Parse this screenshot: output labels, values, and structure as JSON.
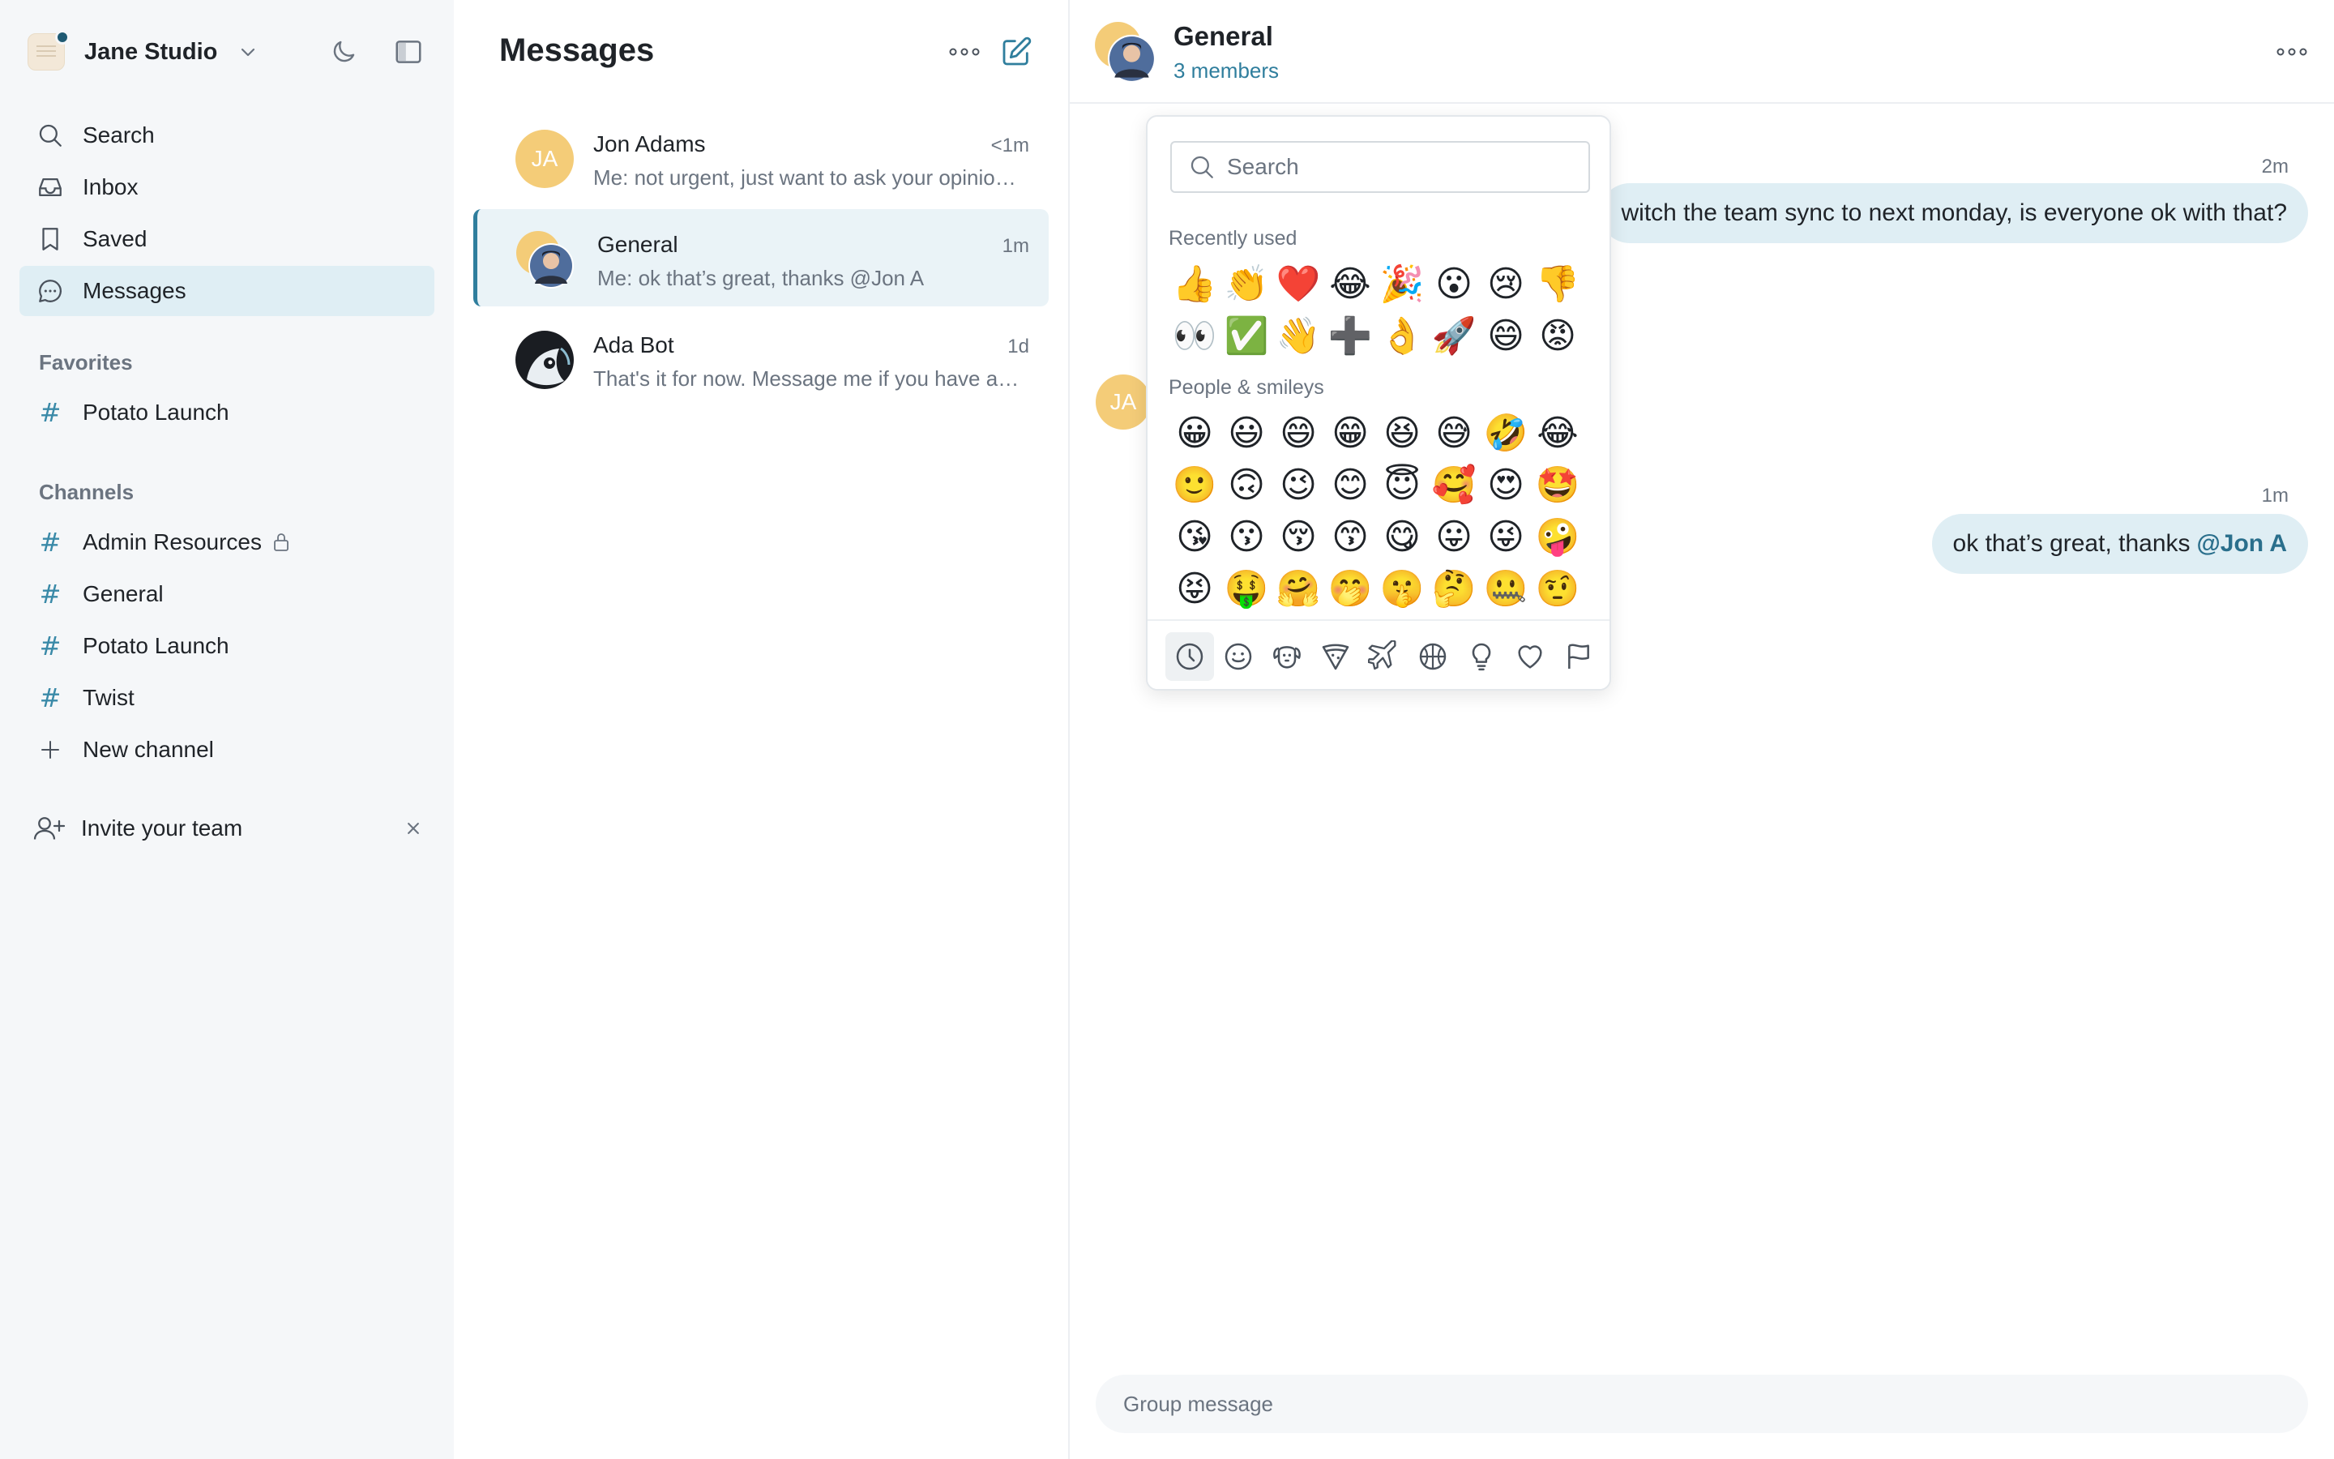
{
  "sidebar": {
    "workspace_name": "Jane Studio",
    "nav": [
      {
        "label": "Search",
        "icon": "search-icon"
      },
      {
        "label": "Inbox",
        "icon": "inbox-icon"
      },
      {
        "label": "Saved",
        "icon": "bookmark-icon"
      },
      {
        "label": "Messages",
        "icon": "chat-bubble-icon",
        "active": true
      }
    ],
    "favorites_title": "Favorites",
    "favorites": [
      "Potato Launch"
    ],
    "channels_title": "Channels",
    "channels": [
      "Admin Resources",
      "General",
      "Potato Launch",
      "Twist"
    ],
    "new_channel": "New channel",
    "invite": "Invite your team"
  },
  "list": {
    "title": "Messages",
    "conversations": [
      {
        "name": "Jon Adams",
        "initials": "JA",
        "time": "<1m",
        "preview": "Me: not urgent, just want to ask your opinion on something"
      },
      {
        "name": "General",
        "time": "1m",
        "preview": "Me: ok that’s great, thanks @Jon A",
        "active": true
      },
      {
        "name": "Ada Bot",
        "time": "1d",
        "preview": "That's it for now. Message me if you have any questions!"
      }
    ]
  },
  "chat": {
    "title": "General",
    "members": "3 members",
    "messages": [
      {
        "time": "2m",
        "text": "witch the team sync to next monday, is everyone ok with that?"
      },
      {
        "time": "1m",
        "text": "ok that’s great, thanks",
        "mention": "@Jon A"
      }
    ],
    "other_avatar_initials": "JA",
    "composer_placeholder": "Group message"
  },
  "emoji_picker": {
    "search_placeholder": "Search",
    "recent_title": "Recently used",
    "recent": [
      "👍",
      "👏",
      "❤️",
      "😂",
      "🎉",
      "😮",
      "😢",
      "👎",
      "👀",
      "✅",
      "👋",
      "➕",
      "👌",
      "🚀",
      "😄",
      "😡"
    ],
    "people_title": "People & smileys",
    "people": [
      "😀",
      "😃",
      "😄",
      "😁",
      "😆",
      "😅",
      "🤣",
      "😂",
      "🙂",
      "🙃",
      "😉",
      "😊",
      "😇",
      "🥰",
      "😍",
      "🤩",
      "😘",
      "😗",
      "😚",
      "😙",
      "😋",
      "😛",
      "😜",
      "🤪",
      "😝",
      "🤑",
      "🤗",
      "🤭",
      "🤫",
      "🤔",
      "🤐",
      "🤨",
      "😐",
      "😑",
      "😶",
      "😏",
      "😒",
      "🙄",
      "😬",
      "🤥"
    ],
    "tabs": [
      "clock-icon",
      "smiley-icon",
      "dog-icon",
      "pizza-icon",
      "airplane-icon",
      "basketball-icon",
      "lightbulb-icon",
      "heart-icon",
      "flag-icon"
    ]
  },
  "colors": {
    "accent": "#2f7e9d",
    "bubble": "#dfeef4",
    "active_nav": "#dfeef4",
    "avatar_ja": "#f4cc78"
  }
}
